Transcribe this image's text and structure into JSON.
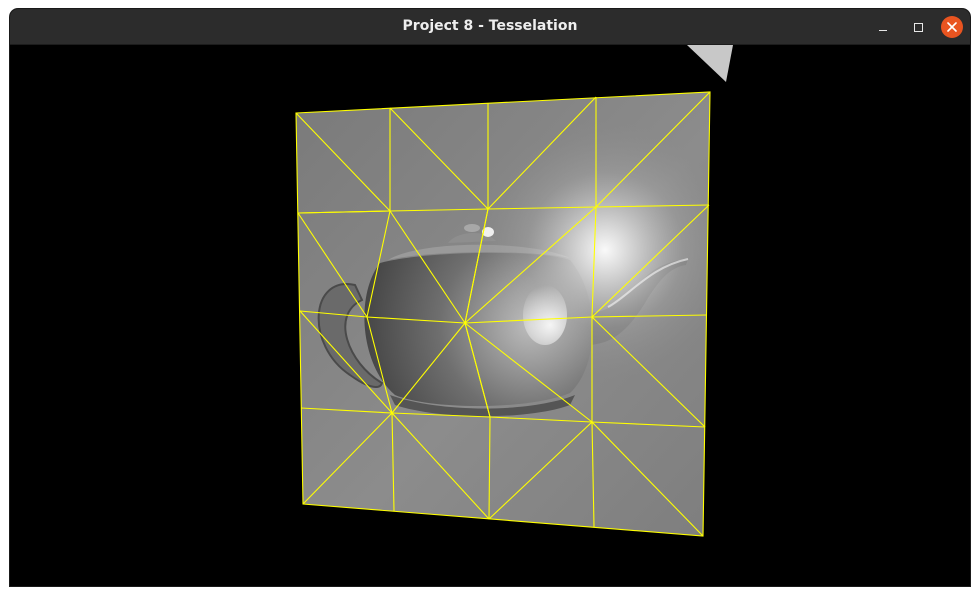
{
  "window": {
    "title": "Project 8 - Tesselation",
    "controls": {
      "minimize": "window-minimize",
      "maximize": "window-maximize",
      "close": "window-close"
    }
  },
  "scene": {
    "background_color": "#000000",
    "wireframe_color": "#ffff00",
    "surface_color": "#8a8a8a",
    "object": "teapot-icon"
  }
}
